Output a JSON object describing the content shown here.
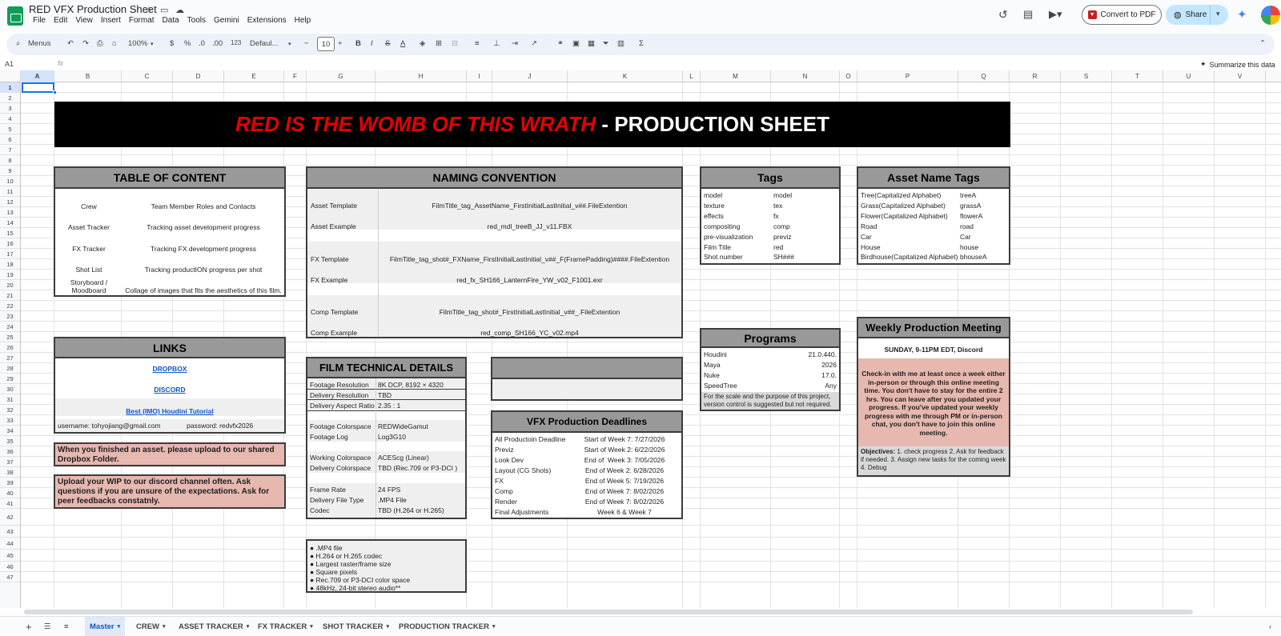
{
  "app": {
    "title": "RED VFX Production Sheet",
    "menu": [
      "File",
      "Edit",
      "View",
      "Insert",
      "Format",
      "Data",
      "Tools",
      "Gemini",
      "Extensions",
      "Help"
    ],
    "convert_label": "Convert to PDF",
    "share_label": "Share"
  },
  "toolbar": {
    "menus_label": "Menus",
    "zoom": "100%",
    "currency": "$",
    "percent": "%",
    "dec_less": ".0",
    "dec_more": ".00",
    "number_format": "123",
    "font": "Defaul...",
    "font_size": "10"
  },
  "formula_bar": {
    "name_box": "A1",
    "fx": "fx",
    "summarize": "Summarize this data"
  },
  "columns": [
    "A",
    "B",
    "C",
    "D",
    "E",
    "F",
    "G",
    "H",
    "I",
    "J",
    "K",
    "L",
    "M",
    "N",
    "O",
    "P",
    "Q",
    "R",
    "S",
    "T",
    "U",
    "V"
  ],
  "rows": [
    "1",
    "2",
    "3",
    "4",
    "5",
    "6",
    "7",
    "8",
    "9",
    "10",
    "11",
    "12",
    "13",
    "14",
    "15",
    "16",
    "17",
    "18",
    "19",
    "20",
    "21",
    "22",
    "23",
    "24",
    "25",
    "26",
    "27",
    "28",
    "29",
    "30",
    "31",
    "32",
    "33",
    "34",
    "35",
    "36",
    "37",
    "38",
    "39",
    "40",
    "41",
    "42",
    "43",
    "44",
    "45",
    "46",
    "47"
  ],
  "banner": {
    "red_text": "RED IS THE WOMB OF THIS WRATH",
    "white_text": " - PRODUCTION SHEET"
  },
  "toc": {
    "title": "TABLE OF CONTENT",
    "items": [
      {
        "name": "Crew",
        "desc": "Team Member Roles and Contacts"
      },
      {
        "name": "Asset Tracker",
        "desc": "Tracking asset development progress"
      },
      {
        "name": "FX Tracker",
        "desc": "Tracking FX development progress"
      },
      {
        "name": "Shot List",
        "desc": "Tracking productION progress per shot"
      },
      {
        "name": "Storyboard /\nMoodboard",
        "desc": "Collage of images that fits the aesthetics of this film."
      }
    ]
  },
  "naming": {
    "title": "NAMING CONVENTION",
    "rows": [
      {
        "label": "Asset Template",
        "value": "FilmTitle_tag_AssetName_FirstInitialLastInitial_v##.FileExtention"
      },
      {
        "label": "Asset Example",
        "value": "red_mdl_treeB_JJ_v11.FBX"
      },
      {
        "label": "FX Template",
        "value": "FilmTitle_tag_shot#_FXName_FirstInitialLastInitial_v##_F(FramePadding)####.FileExtention"
      },
      {
        "label": "FX Example",
        "value": "red_fx_SH166_LanternFire_YW_v02_F1001.exr"
      },
      {
        "label": "Comp Template",
        "value": "FilmTitle_tag_shot#_FirstInitialLastInitial_v##_.FileExtention"
      },
      {
        "label": "Comp Example",
        "value": "red_comp_SH166_YC_v02.mp4"
      }
    ]
  },
  "tags": {
    "title": "Tags",
    "rows": [
      [
        "model",
        "model"
      ],
      [
        "texture",
        "tex"
      ],
      [
        "effects",
        "fx"
      ],
      [
        "compositing",
        "comp"
      ],
      [
        "pre-visualization",
        "previz"
      ],
      [
        "Film Title",
        "red"
      ],
      [
        "Shot number",
        "SH###"
      ]
    ]
  },
  "asset_tags": {
    "title": "Asset Name Tags",
    "rows": [
      [
        "Tree(Capitalized Alphabet)",
        "treeA"
      ],
      [
        "Grass(Capitalized Alphabet)",
        "grassA"
      ],
      [
        "Flower(Capitalized Alphabet)",
        "flowerA"
      ],
      [
        "Road",
        "road"
      ],
      [
        "Car",
        "Car"
      ],
      [
        "House",
        "house"
      ],
      [
        "Birdhouse(Capitalized Alphabet)",
        "bhouseA"
      ]
    ]
  },
  "links": {
    "title": "LINKS",
    "dropbox": "DROPBOX",
    "discord": "DISCORD",
    "tutorial": "Best (IMO) Houdini Tutorial",
    "username": "username: tohyojiang@gmail.com",
    "password": "password: redvfx2026"
  },
  "notes": {
    "upload": "When you finished an asset. please upload to our shared Dropbox Folder.",
    "wip": "Upload your WIP to our discord channel often. Ask questions if you are unsure of the expectations. Ask for peer feedbacks constatnly."
  },
  "programs": {
    "title": "Programs",
    "rows": [
      [
        "Houdini",
        "21.0.440."
      ],
      [
        "Maya",
        "2026"
      ],
      [
        "Nuke",
        "17.0."
      ],
      [
        "SpeedTree",
        "Any"
      ]
    ],
    "note": "For the scale and the purpose of this project, version control is suggested but not required."
  },
  "meeting": {
    "title": "Weekly Production Meeting",
    "time": "SUNDAY, 9-11PM EDT, Discord",
    "body": "Check-in with me at least once a week either in-person or through this online meeting time. You don't have to stay for the entire 2 hrs. You can leave after you updated your progress. If you've updated your weekly progress with me through PM or in-person chat, you don't have to join this online meeting.",
    "objectives_label": "Objectives:",
    "objectives": " 1. check progress 2. Ask for feedback if needed. 3. Assign new tasks for the coming week 4. Debug"
  },
  "film_tech": {
    "title": "FILM TECHNICAL DETAILS",
    "group1": [
      [
        "Footage Resolution",
        "8K DCP, 8192 × 4320"
      ],
      [
        "Delivery Resolution",
        "TBD"
      ],
      [
        "Delivery Aspect Ratio",
        "2.35 : 1"
      ]
    ],
    "group2": [
      [
        "Footage Colorspace",
        "REDWideGamut"
      ],
      [
        "Footage Log",
        "Log3G10"
      ]
    ],
    "group3": [
      [
        "Working Colorspace",
        "ACEScg (Linear)"
      ],
      [
        "Delivery Colorspace",
        "TBD (Rec.709 or P3-DCI )"
      ]
    ],
    "group4": [
      [
        "Frame Rate",
        "24 FPS"
      ],
      [
        "Delivery File Type",
        ".MP4 File"
      ],
      [
        "Codec",
        "TBD (H.264 or H.265)"
      ]
    ]
  },
  "deadlines": {
    "title": "VFX Production Deadlines",
    "rows": [
      [
        "All Productoin Deadline",
        "Start of Week 7: 7/27/2026"
      ],
      [
        "Previz",
        "Start of Week 2: 6/22/2026"
      ],
      [
        "Look Dev",
        "End of  Week 3: 7/05/2026"
      ],
      [
        "Layout (CG Shots)",
        "End of Week 2: 6/28/2026"
      ],
      [
        "FX",
        "End of Week 5: 7/19/2026"
      ],
      [
        "Comp",
        "End of Week 7: 8/02/2026"
      ],
      [
        "Render",
        "End of Week 7: 8/02/2026"
      ],
      [
        "Final Adjustments",
        "Week 6 & Week 7"
      ]
    ]
  },
  "delivery_specs": [
    "● .MP4 file",
    "● H.264 or H.265 codec",
    "● Largest raster/frame size",
    "● Square pixels",
    "● Rec.709 or P3-DCI color space",
    "● 48kHz, 24-bit stereo audio**"
  ],
  "sheet_tabs": [
    "Master",
    "CREW",
    "ASSET TRACKER",
    "FX TRACKER",
    "SHOT TRACKER",
    "PRODUCTION TRACKER"
  ]
}
